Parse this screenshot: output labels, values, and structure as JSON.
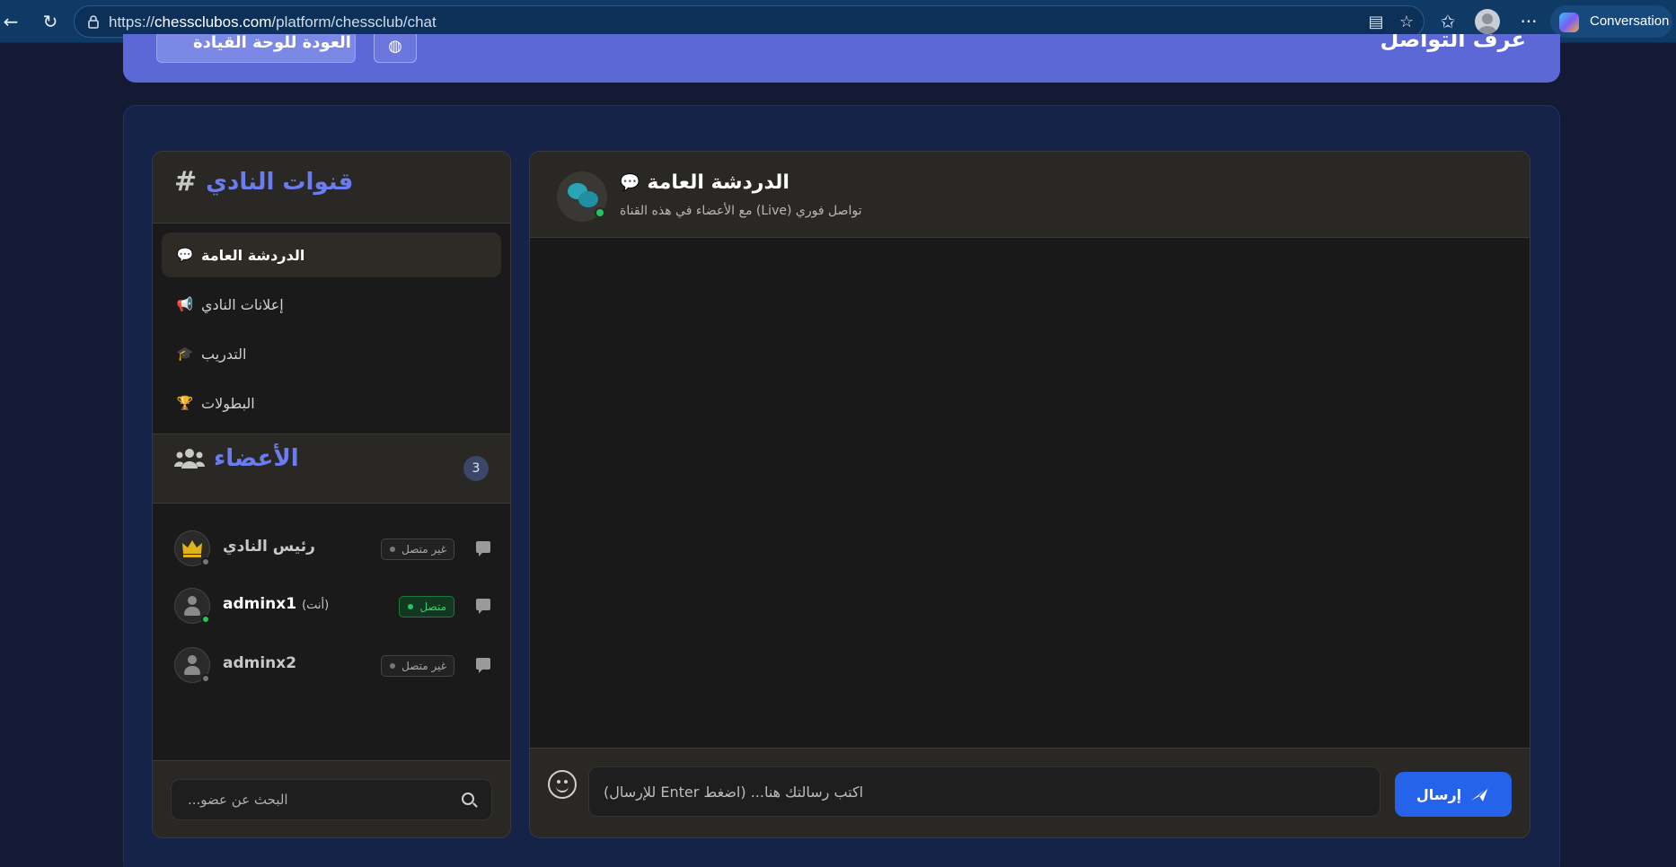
{
  "browser": {
    "url_prefix": "https://",
    "url_host": "chessclubos.com",
    "url_path": "/platform/chessclub/chat",
    "conversation_label": "Conversation"
  },
  "banner": {
    "title": "غرف التواصل",
    "back_label": "العودة للوحة القيادة"
  },
  "chat": {
    "title": "الدردشة العامة",
    "title_emoji": "💬",
    "subtitle": "تواصل فوري (Live) مع الأعضاء في هذه القناة",
    "input_placeholder": "اكتب رسالتك هنا... (اضغط Enter للإرسال)",
    "send_label": "إرسال"
  },
  "sidebar": {
    "channels_title": "قنوات النادي",
    "channels": [
      {
        "emoji": "💬",
        "label": "الدردشة العامة",
        "active": true
      },
      {
        "emoji": "📢",
        "label": "إعلانات النادي",
        "active": false
      },
      {
        "emoji": "🎓",
        "label": "التدريب",
        "active": false
      },
      {
        "emoji": "🏆",
        "label": "البطولات",
        "active": false
      }
    ],
    "members_title": "الأعضاء",
    "members_count": "3",
    "members": [
      {
        "name": "رئيس النادي",
        "status": "غير متصل",
        "online": false,
        "you": "",
        "avatar": "crown-icon"
      },
      {
        "name": "adminx1",
        "status": "متصل",
        "online": true,
        "you": "(أنت)",
        "avatar": "user-icon"
      },
      {
        "name": "adminx2",
        "status": "غير متصل",
        "online": false,
        "you": "",
        "avatar": "user-icon"
      }
    ],
    "search_placeholder": "البحث عن عضو..."
  },
  "colors": {
    "accent": "#5b68d6",
    "send": "#2563eb",
    "online": "#22c55e"
  }
}
